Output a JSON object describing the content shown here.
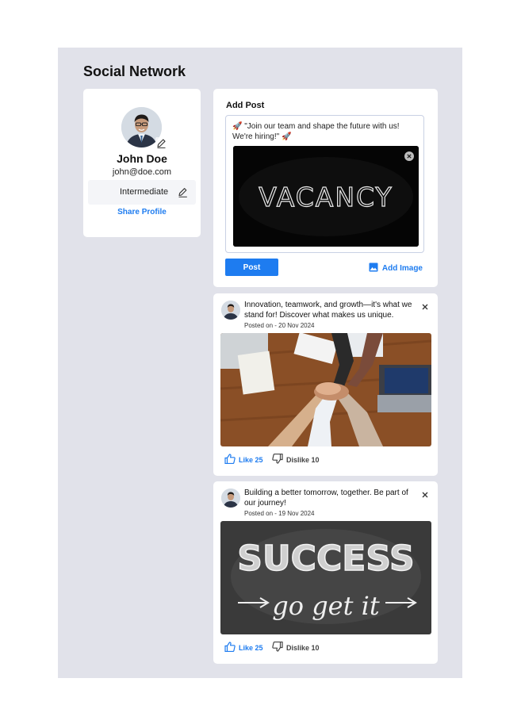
{
  "app": {
    "title": "Social Network"
  },
  "profile": {
    "name": "John Doe",
    "email": "john@doe.com",
    "level": "Intermediate",
    "share_label": "Share Profile"
  },
  "add_post": {
    "title": "Add Post",
    "draft_text": "🚀 \"Join our team and shape the future with us! We're hiring!\" 🚀",
    "image_word": "VACANCY",
    "post_label": "Post",
    "add_image_label": "Add Image"
  },
  "posts": [
    {
      "text": "Innovation, teamwork, and growth—it's what we stand for! Discover what makes us unique.",
      "date": "Posted on - 20 Nov 2024",
      "like_label": "Like 25",
      "dislike_label": "Dislike 10"
    },
    {
      "text": "Building a better tomorrow, together. Be part of our journey!",
      "date": "Posted on - 19 Nov 2024",
      "image_words": [
        "SUCCESS",
        "go get it"
      ],
      "like_label": "Like 25",
      "dislike_label": "Dislike 10"
    }
  ],
  "colors": {
    "accent": "#1e7cf0",
    "canvas": "#e1e2ea",
    "card": "#ffffff"
  },
  "icons": [
    "pencil-icon",
    "close-circle-icon",
    "image-icon",
    "close-icon",
    "thumbs-up-icon",
    "thumbs-down-icon"
  ]
}
